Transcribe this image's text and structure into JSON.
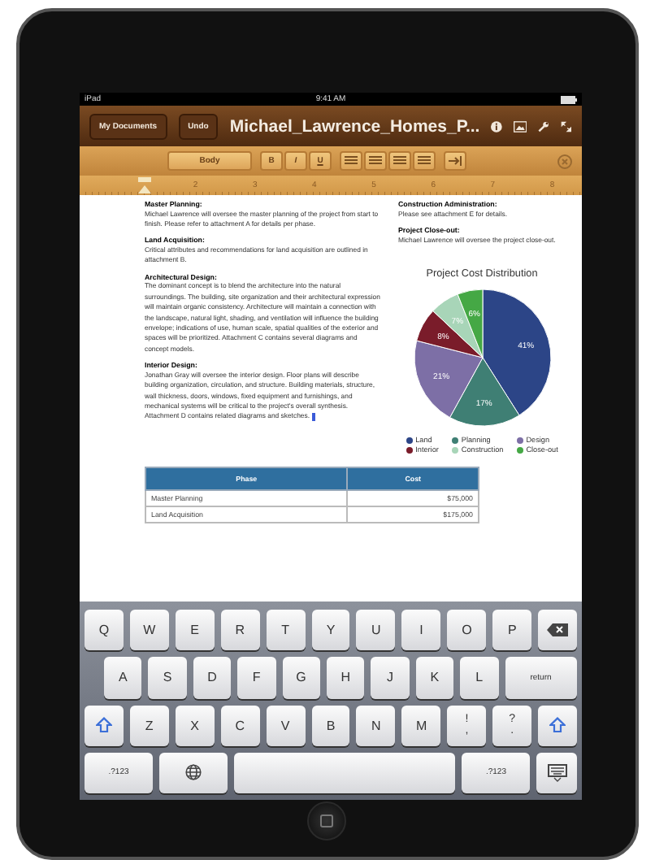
{
  "status_bar": {
    "device": "iPad",
    "time": "9:41 AM"
  },
  "toolbar": {
    "buttons": [
      "My Documents",
      "Undo"
    ],
    "title": "Michael_Lawrence_Homes_P..."
  },
  "format_bar": {
    "style": "Body",
    "text_buttons": [
      "B",
      "I",
      "U"
    ]
  },
  "ruler": {
    "marks": [
      "2",
      "3",
      "4",
      "5",
      "6",
      "7",
      "8"
    ]
  },
  "document": {
    "left_sections": [
      {
        "heading": "Master Planning:",
        "body": "Michael Lawrence will oversee the master planning of the project from start to finish.  Please refer to attachment A for details per phase."
      },
      {
        "heading": "Land Acquisition:",
        "body": "Critical attributes and recommendations for land acquisition are outlined in attachment B."
      },
      {
        "heading": "Architectural Design:",
        "body": "The dominant concept is to blend the architecture into the natural surroundings.  The building, site organization and their architectural expression will maintain organic consistency.  Architecture will maintain a connection with the landscape, natural light, shading, and ventilation will influence the building envelope; indications of use, human scale, spatial qualities of the exterior and spaces will be prioritized. Attachment C contains several diagrams and concept models."
      },
      {
        "heading": "Interior  Design:",
        "body": "Jonathan Gray will oversee the interior design.  Floor plans will describe building organization, circulation, and structure.  Building materials, structure, wall thickness, doors, windows, fixed equipment and furnishings, and mechanical systems will be critical to the project's overall synthesis.  Attachment D contains related diagrams and sketches."
      }
    ],
    "right_sections": [
      {
        "heading": "Construction Administration:",
        "body": "Please see attachment E for details."
      },
      {
        "heading": "Project Close-out:",
        "body": "Michael Lawrence will oversee the project close-out."
      }
    ],
    "chart": {
      "chart_data": {
        "type": "pie",
        "title": "Project Cost Distribution",
        "categories": [
          "Land",
          "Planning",
          "Design",
          "Interior",
          "Construction",
          "Close-out"
        ],
        "values": [
          41,
          17,
          21,
          8,
          7,
          6
        ],
        "value_labels": [
          "41%",
          "17%",
          "21%",
          "8%",
          "7%",
          "6%"
        ],
        "legend": "bottom"
      },
      "slices": [
        {
          "color": "#2c4587"
        },
        {
          "color": "#3f7f74"
        },
        {
          "color": "#7d6fa6"
        },
        {
          "color": "#7a1c2a"
        },
        {
          "color": "#a8d5b8"
        },
        {
          "color": "#45a845"
        }
      ]
    },
    "table": {
      "columns": [
        "Phase",
        "Cost"
      ],
      "rows": [
        [
          "Master Planning",
          "$75,000"
        ],
        [
          "Land Acquisition",
          "$175,000"
        ]
      ]
    }
  },
  "keyboard": {
    "rows": [
      [
        {
          "kind": "letter",
          "label": "Q"
        },
        {
          "kind": "letter",
          "label": "W"
        },
        {
          "kind": "letter",
          "label": "E"
        },
        {
          "kind": "letter",
          "label": "R"
        },
        {
          "kind": "letter",
          "label": "T"
        },
        {
          "kind": "letter",
          "label": "Y"
        },
        {
          "kind": "letter",
          "label": "U"
        },
        {
          "kind": "letter",
          "label": "I"
        },
        {
          "kind": "letter",
          "label": "O"
        },
        {
          "kind": "letter",
          "label": "P"
        },
        {
          "kind": "delete"
        }
      ],
      [
        {
          "kind": "letter",
          "label": "A"
        },
        {
          "kind": "letter",
          "label": "S"
        },
        {
          "kind": "letter",
          "label": "D"
        },
        {
          "kind": "letter",
          "label": "F"
        },
        {
          "kind": "letter",
          "label": "G"
        },
        {
          "kind": "letter",
          "label": "H"
        },
        {
          "kind": "letter",
          "label": "J"
        },
        {
          "kind": "letter",
          "label": "K"
        },
        {
          "kind": "letter",
          "label": "L"
        },
        {
          "kind": "return",
          "label": "return"
        }
      ],
      [
        {
          "kind": "shift"
        },
        {
          "kind": "letter",
          "label": "Z"
        },
        {
          "kind": "letter",
          "label": "X"
        },
        {
          "kind": "letter",
          "label": "C"
        },
        {
          "kind": "letter",
          "label": "V"
        },
        {
          "kind": "letter",
          "label": "B"
        },
        {
          "kind": "letter",
          "label": "N"
        },
        {
          "kind": "letter",
          "label": "M"
        },
        {
          "kind": "symbol",
          "label": "!",
          "sub": ","
        },
        {
          "kind": "symbol",
          "label": "?",
          "sub": "."
        },
        {
          "kind": "shift"
        }
      ],
      [
        {
          "kind": "numbers",
          "label": ".?123"
        },
        {
          "kind": "globe"
        },
        {
          "kind": "space"
        },
        {
          "kind": "numbers",
          "label": ".?123"
        },
        {
          "kind": "hide"
        }
      ]
    ]
  }
}
